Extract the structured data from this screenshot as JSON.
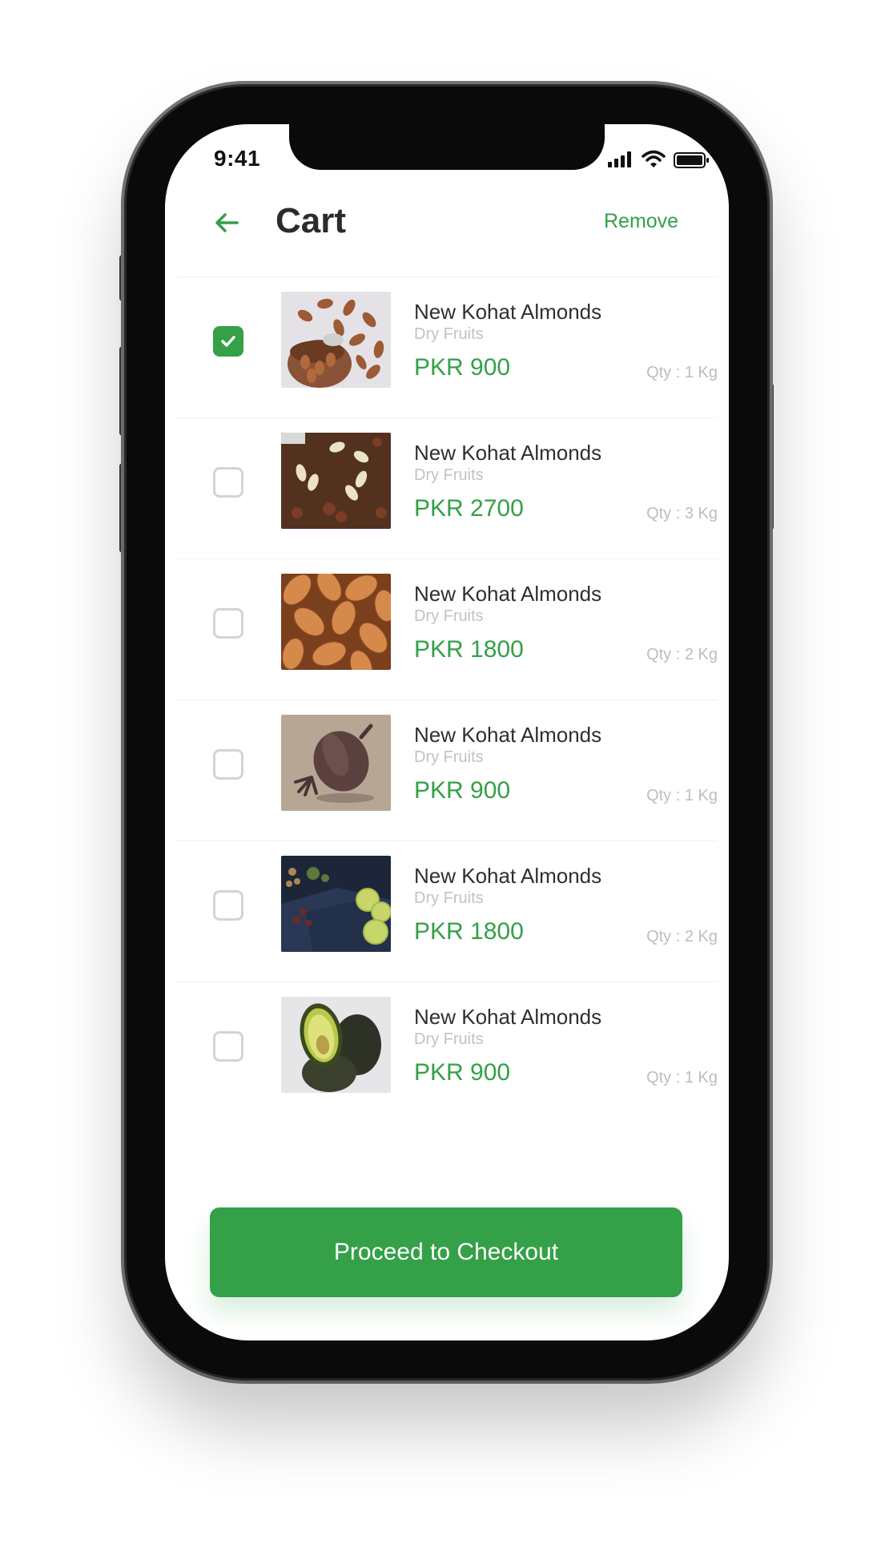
{
  "status_bar": {
    "time": "9:41"
  },
  "header": {
    "title": "Cart",
    "remove_label": "Remove"
  },
  "items": [
    {
      "name": "New Kohat Almonds",
      "category": "Dry Fruits",
      "price": "PKR 900",
      "qty": "Qty : 1 Kg",
      "checked": true,
      "image": "almonds-bowl"
    },
    {
      "name": "New Kohat Almonds",
      "category": "Dry Fruits",
      "price": "PKR 2700",
      "qty": "Qty : 3 Kg",
      "checked": false,
      "image": "mixed-nuts"
    },
    {
      "name": "New Kohat Almonds",
      "category": "Dry Fruits",
      "price": "PKR 1800",
      "qty": "Qty : 2 Kg",
      "checked": false,
      "image": "almonds-closeup"
    },
    {
      "name": "New Kohat Almonds",
      "category": "Dry Fruits",
      "price": "PKR 900",
      "qty": "Qty : 1 Kg",
      "checked": false,
      "image": "poppy-pod"
    },
    {
      "name": "New Kohat Almonds",
      "category": "Dry Fruits",
      "price": "PKR 1800",
      "qty": "Qty : 2 Kg",
      "checked": false,
      "image": "lime-spices"
    },
    {
      "name": "New Kohat Almonds",
      "category": "Dry Fruits",
      "price": "PKR 900",
      "qty": "Qty : 1 Kg",
      "checked": false,
      "image": "avocado"
    }
  ],
  "checkout": {
    "label": "Proceed to Checkout"
  },
  "colors": {
    "accent": "#34a047",
    "text": "#2f2f2f",
    "muted": "#c2c2c2"
  }
}
